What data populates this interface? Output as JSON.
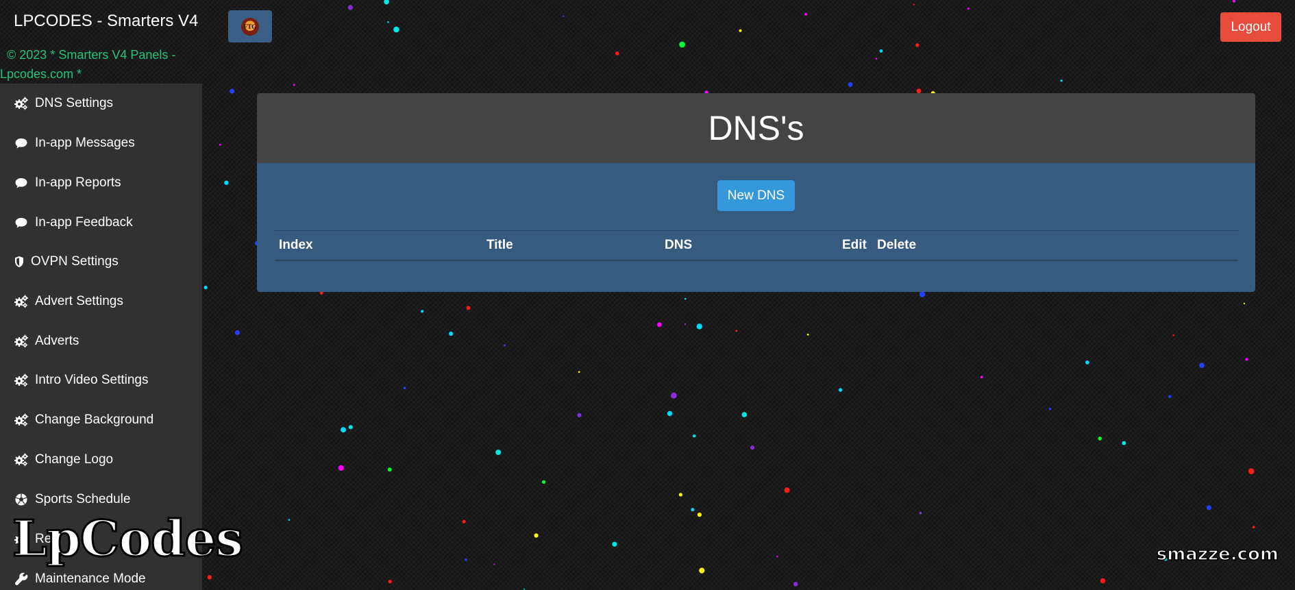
{
  "header": {
    "brand": "LPCODES - Smarters V4",
    "logo_text": "FTG",
    "copyright_line1": "© 2023 * Smarters V4 Panels -",
    "copyright_line2": "Lpcodes.com *",
    "logout_label": "Logout"
  },
  "sidebar": {
    "items": [
      {
        "label": "DNS Settings",
        "icon": "gears-icon"
      },
      {
        "label": "In-app Messages",
        "icon": "comment-icon"
      },
      {
        "label": "In-app Reports",
        "icon": "comment-icon"
      },
      {
        "label": "In-app Feedback",
        "icon": "comment-icon"
      },
      {
        "label": "OVPN Settings",
        "icon": "shield-icon"
      },
      {
        "label": "Advert Settings",
        "icon": "gears-icon"
      },
      {
        "label": "Adverts",
        "icon": "gears-icon"
      },
      {
        "label": "Intro Video Settings",
        "icon": "gears-icon"
      },
      {
        "label": "Change Background",
        "icon": "gears-icon"
      },
      {
        "label": "Change Logo",
        "icon": "gears-icon"
      },
      {
        "label": "Sports Schedule",
        "icon": "soccer-ball-icon"
      },
      {
        "label": "Re",
        "icon": "gears-icon"
      },
      {
        "label": "Maintenance Mode",
        "icon": "wrench-icon"
      }
    ]
  },
  "main": {
    "title": "DNS's",
    "new_button": "New DNS",
    "columns": [
      "Index",
      "Title",
      "DNS",
      "Edit",
      "Delete"
    ],
    "rows": []
  },
  "watermarks": {
    "left": "LpCodes",
    "right": "smazze.com"
  },
  "colors": {
    "background": "#1b1b1b",
    "sidebar": "#313131",
    "panel": "#375a7f",
    "panel_header": "#444444",
    "primary_button": "#3498db",
    "danger_button": "#e74c3c",
    "copyright_text": "#21c57a"
  }
}
